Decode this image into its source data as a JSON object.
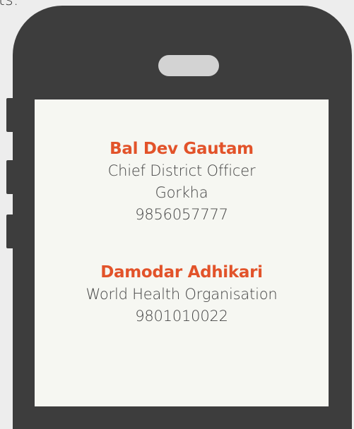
{
  "page": {
    "top_fragment": "ts."
  },
  "contacts": [
    {
      "name": "Bal Dev Gautam",
      "lines": [
        "Chief District Officer",
        "Gorkha",
        "9856057777"
      ]
    },
    {
      "name": "Damodar Adhikari",
      "lines": [
        "World Health Organisation",
        "9801010022"
      ]
    }
  ],
  "colors": {
    "background": "#ededed",
    "phone_body": "#3d3d3d",
    "screen": "#f6f7f2",
    "speaker": "#d3d3d3",
    "name_accent": "#e2532a",
    "text": "#444444"
  }
}
